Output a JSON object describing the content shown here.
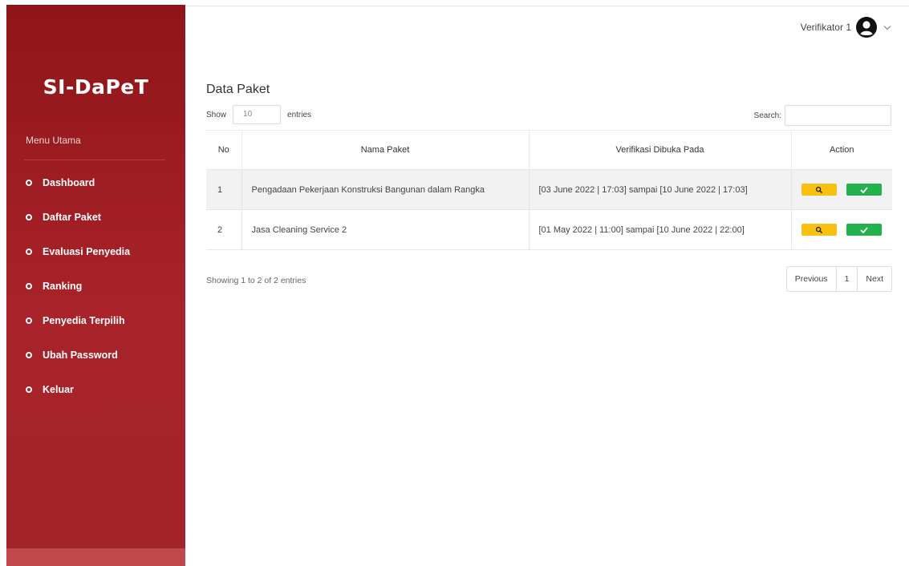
{
  "sidebar": {
    "brand": "SI-DaPeT",
    "menu_title": "Menu Utama",
    "items": [
      {
        "label": "Dashboard"
      },
      {
        "label": "Daftar Paket"
      },
      {
        "label": "Evaluasi Penyedia"
      },
      {
        "label": "Ranking"
      },
      {
        "label": "Penyedia Terpilih"
      },
      {
        "label": "Ubah Password"
      },
      {
        "label": "Keluar"
      }
    ]
  },
  "header": {
    "user_name": "Verifikator 1",
    "user_icon": "user-circle-icon",
    "dropdown_icon": "chevron-down-icon"
  },
  "main": {
    "title": "Data Paket",
    "show_label": "Show",
    "entries_value": "10",
    "entries_label": "entries",
    "search_label": "Search:",
    "search_value": ""
  },
  "table": {
    "columns": [
      "No",
      "Nama Paket",
      "Verifikasi Dibuka Pada",
      "Action"
    ],
    "rows": [
      {
        "no": "1",
        "name": "Pengadaan Pekerjaan Konstruksi Bangunan dalam Rangka",
        "ver": "[03 June 2022 | 17:03] sampai [10 June 2022 | 17:03]"
      },
      {
        "no": "2",
        "name": "Jasa Cleaning Service 2",
        "ver": "[01 May 2022 | 11:00] sampai [10 June 2022 | 22:00]"
      }
    ]
  },
  "footer": {
    "info": "Showing 1 to 2 of 2 entries",
    "prev": "Previous",
    "page": "1",
    "next": "Next"
  },
  "colors": {
    "sidebar": "#a12329",
    "view_button": "#f8c00f",
    "approve_button": "#22b14c"
  }
}
